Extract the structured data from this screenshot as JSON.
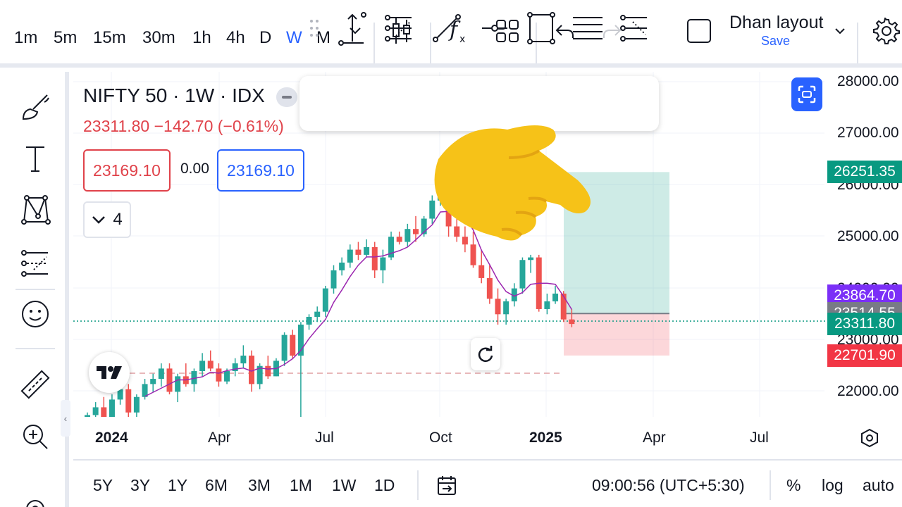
{
  "timeframes": [
    "1m",
    "5m",
    "15m",
    "30m",
    "1h",
    "4h",
    "D",
    "W",
    "M"
  ],
  "active_timeframe": "W",
  "toolbar": {
    "chevron_icon": "chevron-down-icon",
    "candles_icon": "candlestick-icon",
    "indicators_icon": "fx-icon",
    "layouts_icon": "grid-icon",
    "undo_icon": "undo-icon",
    "redo_icon": "redo-icon",
    "layout_name": "Dhan layout",
    "layout_save": "Save",
    "settings_icon": "gear-icon"
  },
  "left_tools": [
    "brush-icon",
    "text-icon",
    "pattern-icon",
    "fib-icon",
    "emoji-icon",
    "ruler-icon",
    "zoom-in-icon",
    "magnet-icon"
  ],
  "legend": {
    "title": "NIFTY 50 · 1W · IDX",
    "values": "23311.80  −142.70 (−0.61%)",
    "sell_price": "23169.10",
    "spread": "0.00",
    "buy_price": "23169.10",
    "indicators_count": "4"
  },
  "draw_toolbar": [
    "drag-handle-icon",
    "vertical-line-icon",
    "fib-retracement-icon",
    "trend-line-icon",
    "horizontal-ray-icon",
    "rectangle-icon",
    "parallel-lines-icon",
    "pitchfork-icon"
  ],
  "price_axis": [
    "28000.00",
    "27000.00",
    "26000.00",
    "25000.00",
    "24000.00",
    "23000.00",
    "22000.00"
  ],
  "price_tags": [
    {
      "value": "26251.35",
      "color": "#089981"
    },
    {
      "value": "23864.70",
      "color": "#7b2ff7"
    },
    {
      "value": "23514.55",
      "color": "#787b86"
    },
    {
      "value": "23311.80",
      "color": "#089981"
    },
    {
      "value": "22701.90",
      "color": "#f23645"
    }
  ],
  "time_axis": [
    {
      "label": "2024",
      "bold": true
    },
    {
      "label": "Apr",
      "bold": false
    },
    {
      "label": "Jul",
      "bold": false
    },
    {
      "label": "Oct",
      "bold": false
    },
    {
      "label": "2025",
      "bold": true
    },
    {
      "label": "Apr",
      "bold": false
    },
    {
      "label": "Jul",
      "bold": false
    }
  ],
  "ranges": [
    "5Y",
    "3Y",
    "1Y",
    "6M",
    "3M",
    "1M",
    "1W",
    "1D"
  ],
  "clock": "09:00:56 (UTC+5:30)",
  "bottom_right": {
    "percent": "%",
    "log": "log",
    "auto": "auto"
  },
  "colors": {
    "up": "#26a69a",
    "down": "#ef5350",
    "ma": "#9c27b0",
    "accent": "#2962ff"
  },
  "chart_data": {
    "type": "candlestick",
    "symbol": "NIFTY 50",
    "interval": "1W",
    "ylim": [
      21400,
      28300
    ],
    "candles": [
      {
        "o": 21500,
        "h": 21600,
        "l": 21350,
        "c": 21550
      },
      {
        "o": 21550,
        "h": 21800,
        "l": 21450,
        "c": 21700
      },
      {
        "o": 21700,
        "h": 21900,
        "l": 21400,
        "c": 21450
      },
      {
        "o": 21450,
        "h": 21950,
        "l": 21400,
        "c": 21850
      },
      {
        "o": 21850,
        "h": 22200,
        "l": 21750,
        "c": 22050
      },
      {
        "o": 22050,
        "h": 22150,
        "l": 21500,
        "c": 21600
      },
      {
        "o": 21600,
        "h": 21950,
        "l": 21450,
        "c": 21900
      },
      {
        "o": 21900,
        "h": 22250,
        "l": 21850,
        "c": 22150
      },
      {
        "o": 22150,
        "h": 22350,
        "l": 22000,
        "c": 22250
      },
      {
        "o": 22250,
        "h": 22550,
        "l": 22100,
        "c": 22450
      },
      {
        "o": 22450,
        "h": 22550,
        "l": 21950,
        "c": 22000
      },
      {
        "o": 22000,
        "h": 22350,
        "l": 21800,
        "c": 22300
      },
      {
        "o": 22300,
        "h": 22550,
        "l": 22100,
        "c": 22150
      },
      {
        "o": 22150,
        "h": 22450,
        "l": 22000,
        "c": 22400
      },
      {
        "o": 22400,
        "h": 22750,
        "l": 22300,
        "c": 22600
      },
      {
        "o": 22600,
        "h": 22800,
        "l": 22400,
        "c": 22450
      },
      {
        "o": 22450,
        "h": 22550,
        "l": 22100,
        "c": 22200
      },
      {
        "o": 22200,
        "h": 22450,
        "l": 22150,
        "c": 22400
      },
      {
        "o": 22400,
        "h": 22650,
        "l": 22300,
        "c": 22550
      },
      {
        "o": 22550,
        "h": 22900,
        "l": 22450,
        "c": 22700
      },
      {
        "o": 22700,
        "h": 22800,
        "l": 22000,
        "c": 22150
      },
      {
        "o": 22150,
        "h": 22550,
        "l": 22050,
        "c": 22500
      },
      {
        "o": 22500,
        "h": 22700,
        "l": 22250,
        "c": 22300
      },
      {
        "o": 22300,
        "h": 22650,
        "l": 22300,
        "c": 22600
      },
      {
        "o": 22600,
        "h": 23150,
        "l": 22500,
        "c": 23100
      },
      {
        "o": 23100,
        "h": 23200,
        "l": 22650,
        "c": 22700
      },
      {
        "o": 22700,
        "h": 23350,
        "l": 21300,
        "c": 23300
      },
      {
        "o": 23300,
        "h": 23500,
        "l": 23200,
        "c": 23450
      },
      {
        "o": 23450,
        "h": 23650,
        "l": 23350,
        "c": 23550
      },
      {
        "o": 23550,
        "h": 24050,
        "l": 23450,
        "c": 24000
      },
      {
        "o": 24000,
        "h": 24450,
        "l": 23900,
        "c": 24350
      },
      {
        "o": 24350,
        "h": 24600,
        "l": 24250,
        "c": 24500
      },
      {
        "o": 24500,
        "h": 24850,
        "l": 24400,
        "c": 24750
      },
      {
        "o": 24750,
        "h": 24900,
        "l": 24550,
        "c": 24650
      },
      {
        "o": 24650,
        "h": 24950,
        "l": 24600,
        "c": 24800
      },
      {
        "o": 24800,
        "h": 24900,
        "l": 24200,
        "c": 24350
      },
      {
        "o": 24350,
        "h": 24750,
        "l": 24100,
        "c": 24600
      },
      {
        "o": 24600,
        "h": 25100,
        "l": 24550,
        "c": 25000
      },
      {
        "o": 25000,
        "h": 25100,
        "l": 24850,
        "c": 24900
      },
      {
        "o": 24900,
        "h": 25250,
        "l": 24800,
        "c": 25150
      },
      {
        "o": 25150,
        "h": 25400,
        "l": 24900,
        "c": 25050
      },
      {
        "o": 25050,
        "h": 25400,
        "l": 25000,
        "c": 25350
      },
      {
        "o": 25350,
        "h": 25800,
        "l": 25250,
        "c": 25700
      },
      {
        "o": 25700,
        "h": 26250,
        "l": 25600,
        "c": 26150
      },
      {
        "o": 26150,
        "h": 26250,
        "l": 25000,
        "c": 25200
      },
      {
        "o": 25200,
        "h": 25400,
        "l": 24900,
        "c": 25000
      },
      {
        "o": 25000,
        "h": 25200,
        "l": 24700,
        "c": 24850
      },
      {
        "o": 24850,
        "h": 25100,
        "l": 24400,
        "c": 24450
      },
      {
        "o": 24450,
        "h": 24750,
        "l": 24100,
        "c": 24200
      },
      {
        "o": 24200,
        "h": 24450,
        "l": 23700,
        "c": 23800
      },
      {
        "o": 23800,
        "h": 24000,
        "l": 23300,
        "c": 23500
      },
      {
        "o": 23500,
        "h": 23800,
        "l": 23300,
        "c": 23750
      },
      {
        "o": 23750,
        "h": 24100,
        "l": 23650,
        "c": 24000
      },
      {
        "o": 24000,
        "h": 24600,
        "l": 23900,
        "c": 24550
      },
      {
        "o": 24550,
        "h": 24650,
        "l": 24300,
        "c": 24600
      },
      {
        "o": 24600,
        "h": 24650,
        "l": 23550,
        "c": 23600
      },
      {
        "o": 23600,
        "h": 23900,
        "l": 23500,
        "c": 23750
      },
      {
        "o": 23750,
        "h": 24050,
        "l": 23700,
        "c": 23900
      },
      {
        "o": 23900,
        "h": 23950,
        "l": 23350,
        "c": 23400
      },
      {
        "o": 23400,
        "h": 23600,
        "l": 23250,
        "c": 23311.8
      }
    ],
    "position": {
      "target": 26251.35,
      "entry": 23514.55,
      "stop": 22701.9
    }
  }
}
